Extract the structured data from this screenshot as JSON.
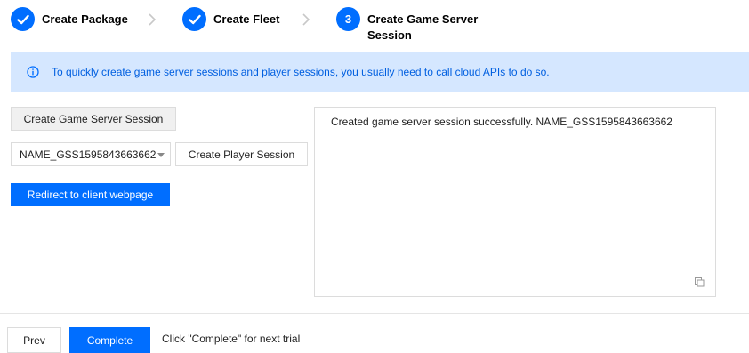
{
  "steps": [
    {
      "label": "Create Package",
      "state": "done",
      "icon": "check-icon"
    },
    {
      "label": "Create Fleet",
      "state": "done",
      "icon": "check-icon"
    },
    {
      "label": "Create Game Server Session",
      "state": "active",
      "number": "3"
    }
  ],
  "info": {
    "icon": "info-icon",
    "text": "To quickly create game server sessions and player sessions, you usually need to call cloud APIs to do so."
  },
  "actions": {
    "create_gss_label": "Create Game Server Session",
    "session_select_value": "NAME_GSS1595843663662",
    "create_player_label": "Create Player Session",
    "redirect_label": "Redirect to client webpage"
  },
  "output": {
    "text": "Created game server session successfully. NAME_GSS1595843663662"
  },
  "footer": {
    "prev_label": "Prev",
    "complete_label": "Complete",
    "hint": "Click \"Complete\" for next trial"
  },
  "colors": {
    "primary": "#006eff",
    "info_bg": "#d5e7ff",
    "info_text": "#005fe0"
  }
}
